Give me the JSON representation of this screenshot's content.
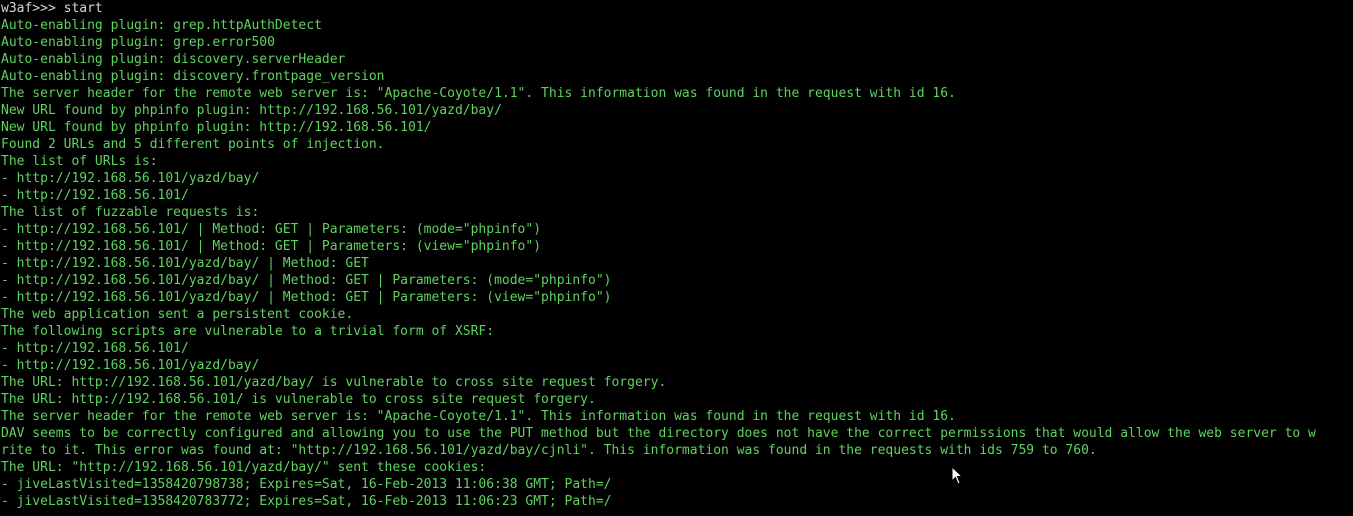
{
  "terminal": {
    "prompt_line": "w3af>>> start",
    "lines": [
      "Auto-enabling plugin: grep.httpAuthDetect",
      "Auto-enabling plugin: grep.error500",
      "Auto-enabling plugin: discovery.serverHeader",
      "Auto-enabling plugin: discovery.frontpage_version",
      "The server header for the remote web server is: \"Apache-Coyote/1.1\". This information was found in the request with id 16.",
      "New URL found by phpinfo plugin: http://192.168.56.101/yazd/bay/",
      "New URL found by phpinfo plugin: http://192.168.56.101/",
      "Found 2 URLs and 5 different points of injection.",
      "The list of URLs is:",
      "- http://192.168.56.101/yazd/bay/",
      "- http://192.168.56.101/",
      "The list of fuzzable requests is:",
      "- http://192.168.56.101/ | Method: GET | Parameters: (mode=\"phpinfo\")",
      "- http://192.168.56.101/ | Method: GET | Parameters: (view=\"phpinfo\")",
      "- http://192.168.56.101/yazd/bay/ | Method: GET",
      "- http://192.168.56.101/yazd/bay/ | Method: GET | Parameters: (mode=\"phpinfo\")",
      "- http://192.168.56.101/yazd/bay/ | Method: GET | Parameters: (view=\"phpinfo\")",
      "The web application sent a persistent cookie.",
      "The following scripts are vulnerable to a trivial form of XSRF:",
      "- http://192.168.56.101/",
      "- http://192.168.56.101/yazd/bay/",
      "The URL: http://192.168.56.101/yazd/bay/ is vulnerable to cross site request forgery.",
      "The URL: http://192.168.56.101/ is vulnerable to cross site request forgery.",
      "The server header for the remote web server is: \"Apache-Coyote/1.1\". This information was found in the request with id 16.",
      "DAV seems to be correctly configured and allowing you to use the PUT method but the directory does not have the correct permissions that would allow the web server to w",
      "rite to it. This error was found at: \"http://192.168.56.101/yazd/bay/cjnli\". This information was found in the requests with ids 759 to 760.",
      "The URL: \"http://192.168.56.101/yazd/bay/\" sent these cookies:",
      "- jiveLastVisited=1358420798738; Expires=Sat, 16-Feb-2013 11:06:38 GMT; Path=/",
      "- jiveLastVisited=1358420783772; Expires=Sat, 16-Feb-2013 11:06:23 GMT; Path=/"
    ]
  },
  "colors": {
    "background": "#000000",
    "output_text": "#5fd35f",
    "prompt_text": "#d8d8d8"
  },
  "cursor": {
    "icon": "mouse-pointer-icon"
  }
}
